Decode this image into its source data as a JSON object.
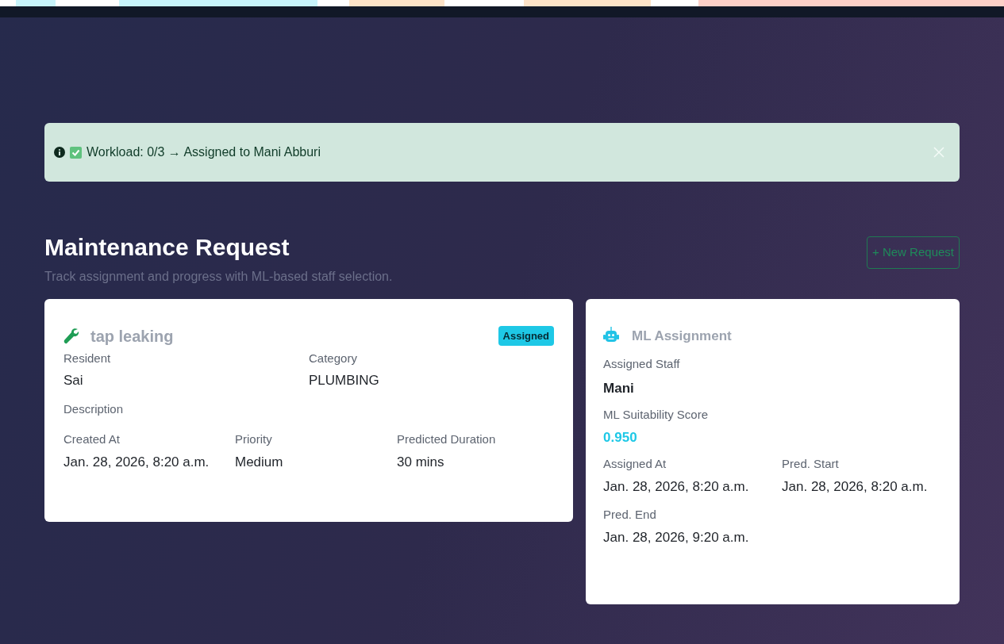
{
  "alert": {
    "message": "Workload: 0/3 → Assigned to Mani Abburi"
  },
  "header": {
    "title": "Maintenance Request",
    "subtitle": "Track assignment and progress with ML-based staff selection.",
    "button": "+ New Request"
  },
  "request_card": {
    "title": "tap leaking",
    "status": "Assigned",
    "fields": [
      {
        "label": "Resident",
        "value": "Sai"
      },
      {
        "label": "Category",
        "value": "PLUMBING"
      },
      {
        "label": "Description"
      }
    ],
    "details": [
      {
        "label": "Created At",
        "value": "Jan. 28, 2026, 8:20 a.m."
      },
      {
        "label": "Priority",
        "value": "Medium"
      },
      {
        "label": "Predicted Duration",
        "value": "30 mins"
      }
    ]
  },
  "ml_card": {
    "title": "ML Assignment",
    "staff_label": "Assigned Staff",
    "staff": "Mani",
    "score_label": "ML Suitability Score",
    "score": "0.950",
    "times": [
      {
        "label": "Assigned At",
        "value": "Jan. 28, 2026, 8:20 a.m."
      },
      {
        "label": "Pred. Start",
        "value": "Jan. 28, 2026, 8:20 a.m."
      },
      {
        "label": "Pred. End",
        "value": "Jan. 28, 2026, 9:20 a.m."
      }
    ]
  }
}
